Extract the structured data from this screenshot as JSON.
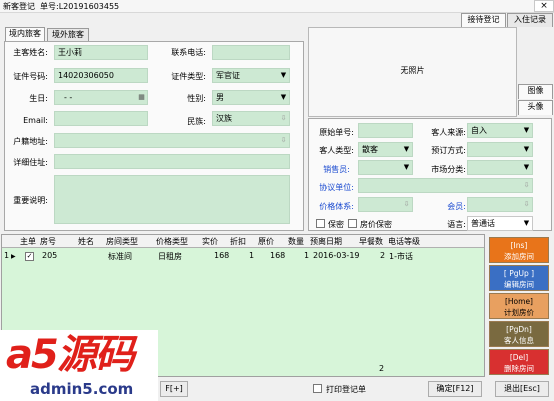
{
  "window": {
    "title": "新客登记",
    "order_label": "单号:L20191603455",
    "close": "×"
  },
  "right_tabs": [
    {
      "label": "接待登记"
    },
    {
      "label": "入住记录"
    }
  ],
  "guest_tabs": [
    {
      "label": "境内旅客"
    },
    {
      "label": "境外旅客"
    }
  ],
  "form": {
    "main_guest_label": "主客姓名:",
    "main_guest_value": "王小莉",
    "phone_label": "联系电话:",
    "phone_value": "",
    "id_no_label": "证件号码:",
    "id_no_value": "14020306050",
    "id_type_label": "证件类型:",
    "id_type_value": "军官证",
    "birthday_label": "生日:",
    "birthday_value": "-  -",
    "gender_label": "性别:",
    "gender_value": "男",
    "email_label": "Email:",
    "email_value": "",
    "ethnic_label": "民族:",
    "ethnic_value": "汉族",
    "household_label": "户籍地址:",
    "household_value": "",
    "address_label": "详细住址:",
    "address_value": "",
    "remarks_label": "重要说明:",
    "remarks_value": ""
  },
  "photo": {
    "text": "无照片",
    "image_tab": "图像",
    "avatar_tab": "头像"
  },
  "right_form": {
    "orig_no_label": "原始单号:",
    "orig_no_value": "",
    "source_label": "客人来源:",
    "source_value": "自入",
    "guest_type_label": "客人类型:",
    "guest_type_value": "散客",
    "booking_label": "预订方式:",
    "booking_value": "",
    "sales_label": "销售员:",
    "sales_value": "",
    "market_label": "市场分类:",
    "market_value": "",
    "agreement_label": "协议单位:",
    "agreement_value": "",
    "price_label": "价格体系:",
    "price_value": "",
    "member_label": "会员:",
    "member_value": "",
    "secret_label": "保密",
    "room_secret_label": "房价保密",
    "lang_label": "语言:",
    "lang_value": "普通话"
  },
  "grid": {
    "headers": [
      "主单",
      "房号",
      "姓名",
      "房间类型",
      "价格类型",
      "实价",
      "折扣",
      "原价",
      "数量",
      "预离日期",
      "早餐数",
      "电话等级"
    ],
    "rows": [
      {
        "idx": "1",
        "main": "",
        "room": "205",
        "name": "",
        "room_type": "标准间",
        "price_type": "日租房",
        "actual": "168",
        "discount": "1",
        "orig": "168",
        "qty": "1",
        "leave": "2016-03-19",
        "breakfast": "2",
        "phone": "1-市话"
      }
    ],
    "footer_count": "2"
  },
  "actions": [
    {
      "key": "[Ins]",
      "label": "添加房间",
      "color": "#e8741a"
    },
    {
      "key": "[ PgUp ]",
      "label": "编辑房间",
      "color": "#3a6fc4"
    },
    {
      "key": "[Home]",
      "label": "计划房价",
      "color": "#e8a060"
    },
    {
      "key": "[PgDn]",
      "label": "客人信息",
      "color": "#7a6a40"
    },
    {
      "key": "[Del]",
      "label": "删除房间",
      "color": "#d83030"
    }
  ],
  "bottom": {
    "left_btn": "F[+]",
    "print_label": "打印登记单",
    "ok_label": "确定[F12]",
    "exit_label": "退出[Esc]"
  },
  "watermark": {
    "brand": "a5源码",
    "site": "admin5.com"
  }
}
